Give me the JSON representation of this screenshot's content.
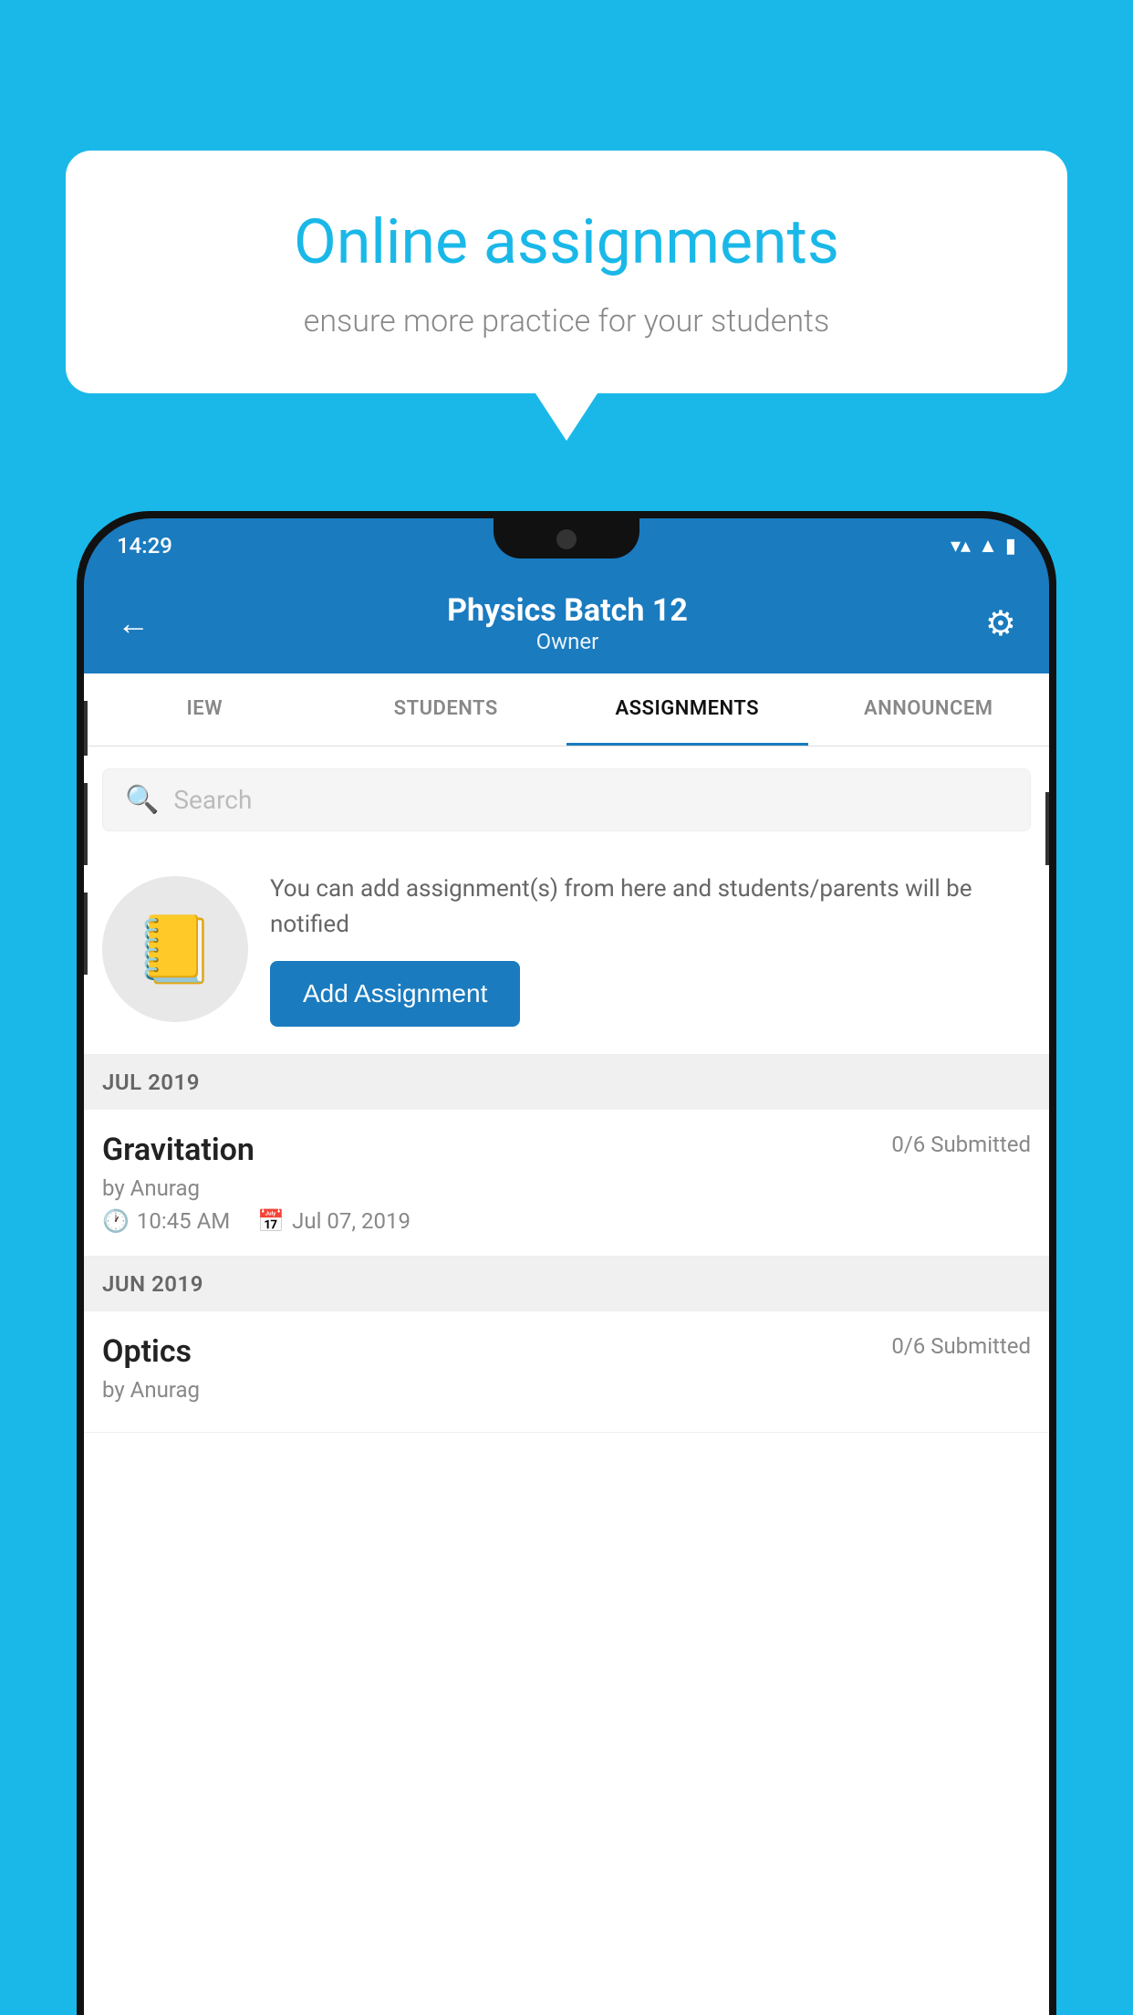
{
  "background_color": "#1ab8e8",
  "speech_bubble": {
    "title": "Online assignments",
    "subtitle": "ensure more practice for your students"
  },
  "status_bar": {
    "time": "14:29",
    "wifi": "▼",
    "signal": "▲",
    "battery": "▮"
  },
  "header": {
    "back_label": "←",
    "title": "Physics Batch 12",
    "subtitle": "Owner",
    "settings_label": "⚙"
  },
  "tabs": [
    {
      "label": "IEW",
      "active": false
    },
    {
      "label": "STUDENTS",
      "active": false
    },
    {
      "label": "ASSIGNMENTS",
      "active": true
    },
    {
      "label": "ANNOUNCEM",
      "active": false
    }
  ],
  "search": {
    "placeholder": "Search"
  },
  "promo": {
    "icon": "📓",
    "text": "You can add assignment(s) from here and students/parents will be notified",
    "button_label": "Add Assignment"
  },
  "sections": [
    {
      "label": "JUL 2019",
      "assignments": [
        {
          "name": "Gravitation",
          "submitted": "0/6 Submitted",
          "author": "by Anurag",
          "time": "10:45 AM",
          "date": "Jul 07, 2019"
        }
      ]
    },
    {
      "label": "JUN 2019",
      "assignments": [
        {
          "name": "Optics",
          "submitted": "0/6 Submitted",
          "author": "by Anurag",
          "time": "",
          "date": ""
        }
      ]
    }
  ]
}
